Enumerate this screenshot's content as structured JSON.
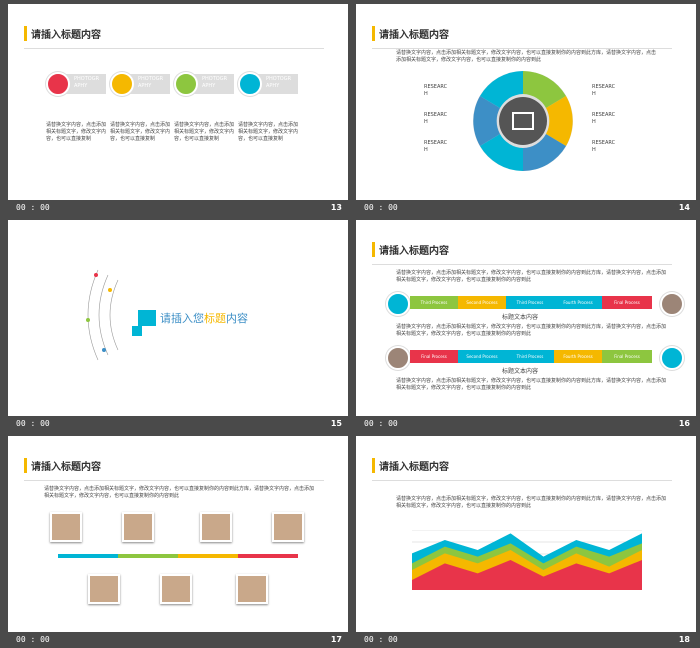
{
  "slides": [
    {
      "num": "13",
      "time": "00 : 00",
      "title": "请插入标题内容",
      "labels": [
        "PHOTOGR\nAPHY",
        "PHOTOGR\nAPHY",
        "PHOTOGR\nAPHY",
        "PHOTOGR\nAPHY"
      ],
      "body": "请替换文字内容，点击添加相关标题文字，修改文字内容，也可以直接复制"
    },
    {
      "num": "14",
      "time": "00 : 00",
      "title": "请插入标题内容",
      "intro": "请替换文字内容，点击添加相关标题文字，修改文字内容，也可以直接复制你的内容到此方库，请替换文字内容，点击添加相关标题文字，修改文字内容，也可以直接复制你的内容到此",
      "items": [
        "RESEARC\nH",
        "RESEARC\nH",
        "RESEARC\nH",
        "RESEARC\nH",
        "RESEARC\nH",
        "RESEARC\nH"
      ],
      "itemtext": "请替换文字内容\n点击添加相关标题文字"
    },
    {
      "num": "15",
      "time": "00 : 00",
      "title_a": "请插入您",
      "title_b": "标题",
      "title_c": "内容"
    },
    {
      "num": "16",
      "time": "00 : 00",
      "title": "请插入标题内容",
      "intro": "请替换文字内容，点击添加相关标题文字，修改文字内容，也可以直接复制你的内容到此方库，请替换文字内容，点击添加相关标题文字，修改文字内容，也可以直接复制你的内容到此",
      "steps1": [
        "Third Process",
        "Second\nProcess",
        "Third Process",
        "Fourth Process",
        "Final Process"
      ],
      "steps2": [
        "Final Process",
        "Second\nProcess",
        "Third Process",
        "Fourth Process",
        "Final Process"
      ],
      "caption": "标题文本内容",
      "text2": "请替换文字内容，点击添加相关标题文字，修改文字内容，也可以直接复制你的内容到此方库，请替换文字内容，点击添加相关标题文字，修改文字内容，也可以直接复制你的内容到此",
      "text3": "请替换文字内容，点击添加相关标题文字，修改文字内容，也可以直接复制你的内容到此方库，请替换文字内容，点击添加相关标题文字，修改文字内容，也可以直接复制你的内容到此"
    },
    {
      "num": "17",
      "time": "00 : 00",
      "title": "请插入标题内容",
      "intro": "请替换文字内容，点击添加相关标题文字，修改文字内容，也可以直接复制你的内容到此方库，请替换文字内容，点击添加相关标题文字，修改文字内容，也可以直接复制你的内容到此"
    },
    {
      "num": "18",
      "time": "00 : 00",
      "title": "请插入标题内容",
      "intro": "请替换文字内容，点击添加相关标题文字，修改文字内容，也可以直接复制你的内容到此方库，请替换文字内容，点击添加相关标题文字，修改文字内容，也可以直接复制你的内容到此"
    }
  ],
  "colors": {
    "red": "#e8344a",
    "yellow": "#f5b800",
    "green": "#8dc63f",
    "teal": "#00b5d5",
    "blue": "#3d8fc6",
    "gray": "#9c8577"
  },
  "chart_data": {
    "type": "area",
    "series": [
      {
        "values": [
          3,
          8,
          5,
          9,
          4,
          8,
          5,
          9
        ]
      },
      {
        "values": [
          6,
          11,
          8,
          12,
          6,
          11,
          7,
          12
        ]
      },
      {
        "values": [
          8,
          13,
          10,
          14,
          8,
          13,
          10,
          14
        ]
      },
      {
        "values": [
          11,
          15,
          12,
          17,
          10,
          15,
          12,
          17
        ]
      }
    ]
  }
}
